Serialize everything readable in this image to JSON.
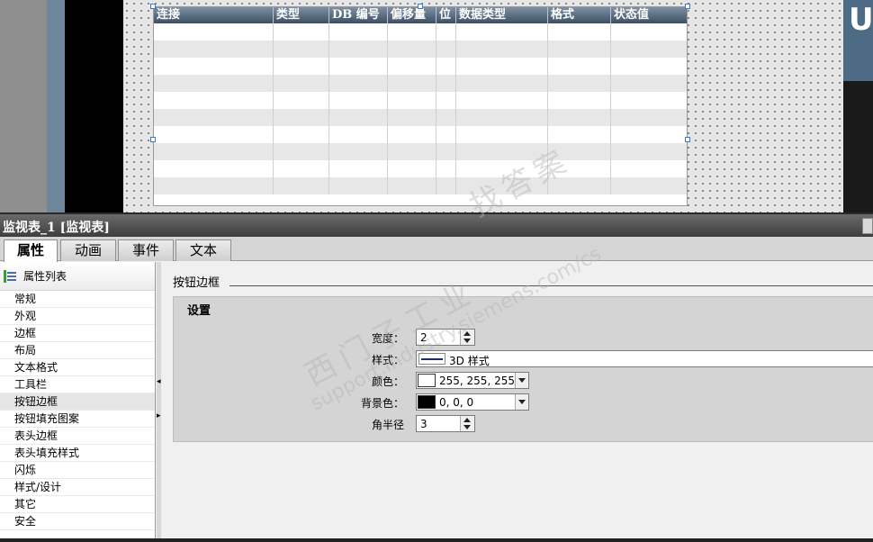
{
  "table": {
    "columns": [
      "连接",
      "类型",
      "DB 编号",
      "偏移量",
      "位",
      "数据类型",
      "格式",
      "状态值"
    ],
    "empty_rows": 10
  },
  "panel": {
    "title": "监视表_1 [监视表]",
    "tabs": [
      {
        "label": "属性",
        "active": true
      },
      {
        "label": "动画",
        "active": false
      },
      {
        "label": "事件",
        "active": false
      },
      {
        "label": "文本",
        "active": false
      }
    ]
  },
  "nav": {
    "header": "属性列表",
    "items": [
      "常规",
      "外观",
      "边框",
      "布局",
      "文本格式",
      "工具栏",
      "按钮边框",
      "按钮填充图案",
      "表头边框",
      "表头填充样式",
      "闪烁",
      "样式/设计",
      "其它",
      "安全"
    ],
    "selected_index": 6
  },
  "content": {
    "section_title": "按钮边框",
    "group_title": "设置",
    "width": {
      "label": "宽度：",
      "value": "2"
    },
    "style": {
      "label": "样式：",
      "value": "3D 样式"
    },
    "color": {
      "label": "颜色：",
      "value": "255, 255, 255",
      "swatch": "#ffffff"
    },
    "bgcolor": {
      "label": "背景色：",
      "value": "0, 0, 0",
      "swatch": "#000000"
    },
    "radius": {
      "label": "角半径",
      "value": "3"
    }
  },
  "watermark": {
    "line1": "西门子工业",
    "line2": "support.industry.siemens.com/cs",
    "line3": "找答案"
  }
}
